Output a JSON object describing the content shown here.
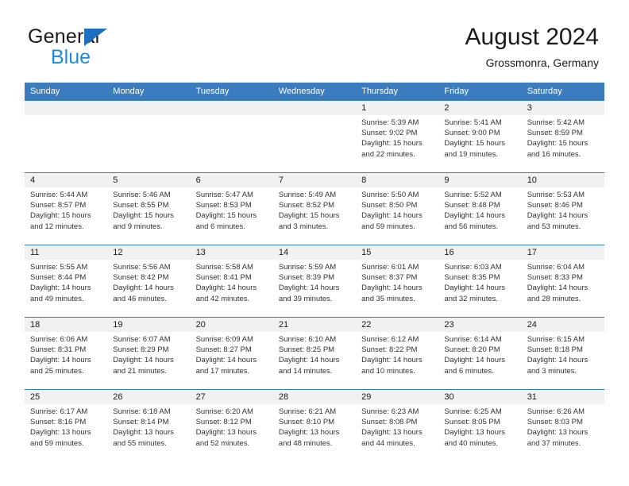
{
  "brand": {
    "line1": "General",
    "line2": "Blue",
    "triangle_color": "#1f6fc0",
    "line2_color": "#1f8bdb"
  },
  "header": {
    "title": "August 2024",
    "subtitle": "Grossmonra, Germany"
  },
  "theme": {
    "header_blue": "#3a7cbe",
    "daynum_strip": "#f1f1f1",
    "text": "#333333"
  },
  "weekday_headers": [
    "Sunday",
    "Monday",
    "Tuesday",
    "Wednesday",
    "Thursday",
    "Friday",
    "Saturday"
  ],
  "weeks": [
    [
      {
        "day": "",
        "sunrise": "",
        "sunset": "",
        "daylight1": "",
        "daylight2": ""
      },
      {
        "day": "",
        "sunrise": "",
        "sunset": "",
        "daylight1": "",
        "daylight2": ""
      },
      {
        "day": "",
        "sunrise": "",
        "sunset": "",
        "daylight1": "",
        "daylight2": ""
      },
      {
        "day": "",
        "sunrise": "",
        "sunset": "",
        "daylight1": "",
        "daylight2": ""
      },
      {
        "day": "1",
        "sunrise": "Sunrise: 5:39 AM",
        "sunset": "Sunset: 9:02 PM",
        "daylight1": "Daylight: 15 hours",
        "daylight2": "and 22 minutes."
      },
      {
        "day": "2",
        "sunrise": "Sunrise: 5:41 AM",
        "sunset": "Sunset: 9:00 PM",
        "daylight1": "Daylight: 15 hours",
        "daylight2": "and 19 minutes."
      },
      {
        "day": "3",
        "sunrise": "Sunrise: 5:42 AM",
        "sunset": "Sunset: 8:59 PM",
        "daylight1": "Daylight: 15 hours",
        "daylight2": "and 16 minutes."
      }
    ],
    [
      {
        "day": "4",
        "sunrise": "Sunrise: 5:44 AM",
        "sunset": "Sunset: 8:57 PM",
        "daylight1": "Daylight: 15 hours",
        "daylight2": "and 12 minutes."
      },
      {
        "day": "5",
        "sunrise": "Sunrise: 5:46 AM",
        "sunset": "Sunset: 8:55 PM",
        "daylight1": "Daylight: 15 hours",
        "daylight2": "and 9 minutes."
      },
      {
        "day": "6",
        "sunrise": "Sunrise: 5:47 AM",
        "sunset": "Sunset: 8:53 PM",
        "daylight1": "Daylight: 15 hours",
        "daylight2": "and 6 minutes."
      },
      {
        "day": "7",
        "sunrise": "Sunrise: 5:49 AM",
        "sunset": "Sunset: 8:52 PM",
        "daylight1": "Daylight: 15 hours",
        "daylight2": "and 3 minutes."
      },
      {
        "day": "8",
        "sunrise": "Sunrise: 5:50 AM",
        "sunset": "Sunset: 8:50 PM",
        "daylight1": "Daylight: 14 hours",
        "daylight2": "and 59 minutes."
      },
      {
        "day": "9",
        "sunrise": "Sunrise: 5:52 AM",
        "sunset": "Sunset: 8:48 PM",
        "daylight1": "Daylight: 14 hours",
        "daylight2": "and 56 minutes."
      },
      {
        "day": "10",
        "sunrise": "Sunrise: 5:53 AM",
        "sunset": "Sunset: 8:46 PM",
        "daylight1": "Daylight: 14 hours",
        "daylight2": "and 53 minutes."
      }
    ],
    [
      {
        "day": "11",
        "sunrise": "Sunrise: 5:55 AM",
        "sunset": "Sunset: 8:44 PM",
        "daylight1": "Daylight: 14 hours",
        "daylight2": "and 49 minutes."
      },
      {
        "day": "12",
        "sunrise": "Sunrise: 5:56 AM",
        "sunset": "Sunset: 8:42 PM",
        "daylight1": "Daylight: 14 hours",
        "daylight2": "and 46 minutes."
      },
      {
        "day": "13",
        "sunrise": "Sunrise: 5:58 AM",
        "sunset": "Sunset: 8:41 PM",
        "daylight1": "Daylight: 14 hours",
        "daylight2": "and 42 minutes."
      },
      {
        "day": "14",
        "sunrise": "Sunrise: 5:59 AM",
        "sunset": "Sunset: 8:39 PM",
        "daylight1": "Daylight: 14 hours",
        "daylight2": "and 39 minutes."
      },
      {
        "day": "15",
        "sunrise": "Sunrise: 6:01 AM",
        "sunset": "Sunset: 8:37 PM",
        "daylight1": "Daylight: 14 hours",
        "daylight2": "and 35 minutes."
      },
      {
        "day": "16",
        "sunrise": "Sunrise: 6:03 AM",
        "sunset": "Sunset: 8:35 PM",
        "daylight1": "Daylight: 14 hours",
        "daylight2": "and 32 minutes."
      },
      {
        "day": "17",
        "sunrise": "Sunrise: 6:04 AM",
        "sunset": "Sunset: 8:33 PM",
        "daylight1": "Daylight: 14 hours",
        "daylight2": "and 28 minutes."
      }
    ],
    [
      {
        "day": "18",
        "sunrise": "Sunrise: 6:06 AM",
        "sunset": "Sunset: 8:31 PM",
        "daylight1": "Daylight: 14 hours",
        "daylight2": "and 25 minutes."
      },
      {
        "day": "19",
        "sunrise": "Sunrise: 6:07 AM",
        "sunset": "Sunset: 8:29 PM",
        "daylight1": "Daylight: 14 hours",
        "daylight2": "and 21 minutes."
      },
      {
        "day": "20",
        "sunrise": "Sunrise: 6:09 AM",
        "sunset": "Sunset: 8:27 PM",
        "daylight1": "Daylight: 14 hours",
        "daylight2": "and 17 minutes."
      },
      {
        "day": "21",
        "sunrise": "Sunrise: 6:10 AM",
        "sunset": "Sunset: 8:25 PM",
        "daylight1": "Daylight: 14 hours",
        "daylight2": "and 14 minutes."
      },
      {
        "day": "22",
        "sunrise": "Sunrise: 6:12 AM",
        "sunset": "Sunset: 8:22 PM",
        "daylight1": "Daylight: 14 hours",
        "daylight2": "and 10 minutes."
      },
      {
        "day": "23",
        "sunrise": "Sunrise: 6:14 AM",
        "sunset": "Sunset: 8:20 PM",
        "daylight1": "Daylight: 14 hours",
        "daylight2": "and 6 minutes."
      },
      {
        "day": "24",
        "sunrise": "Sunrise: 6:15 AM",
        "sunset": "Sunset: 8:18 PM",
        "daylight1": "Daylight: 14 hours",
        "daylight2": "and 3 minutes."
      }
    ],
    [
      {
        "day": "25",
        "sunrise": "Sunrise: 6:17 AM",
        "sunset": "Sunset: 8:16 PM",
        "daylight1": "Daylight: 13 hours",
        "daylight2": "and 59 minutes."
      },
      {
        "day": "26",
        "sunrise": "Sunrise: 6:18 AM",
        "sunset": "Sunset: 8:14 PM",
        "daylight1": "Daylight: 13 hours",
        "daylight2": "and 55 minutes."
      },
      {
        "day": "27",
        "sunrise": "Sunrise: 6:20 AM",
        "sunset": "Sunset: 8:12 PM",
        "daylight1": "Daylight: 13 hours",
        "daylight2": "and 52 minutes."
      },
      {
        "day": "28",
        "sunrise": "Sunrise: 6:21 AM",
        "sunset": "Sunset: 8:10 PM",
        "daylight1": "Daylight: 13 hours",
        "daylight2": "and 48 minutes."
      },
      {
        "day": "29",
        "sunrise": "Sunrise: 6:23 AM",
        "sunset": "Sunset: 8:08 PM",
        "daylight1": "Daylight: 13 hours",
        "daylight2": "and 44 minutes."
      },
      {
        "day": "30",
        "sunrise": "Sunrise: 6:25 AM",
        "sunset": "Sunset: 8:05 PM",
        "daylight1": "Daylight: 13 hours",
        "daylight2": "and 40 minutes."
      },
      {
        "day": "31",
        "sunrise": "Sunrise: 6:26 AM",
        "sunset": "Sunset: 8:03 PM",
        "daylight1": "Daylight: 13 hours",
        "daylight2": "and 37 minutes."
      }
    ]
  ]
}
